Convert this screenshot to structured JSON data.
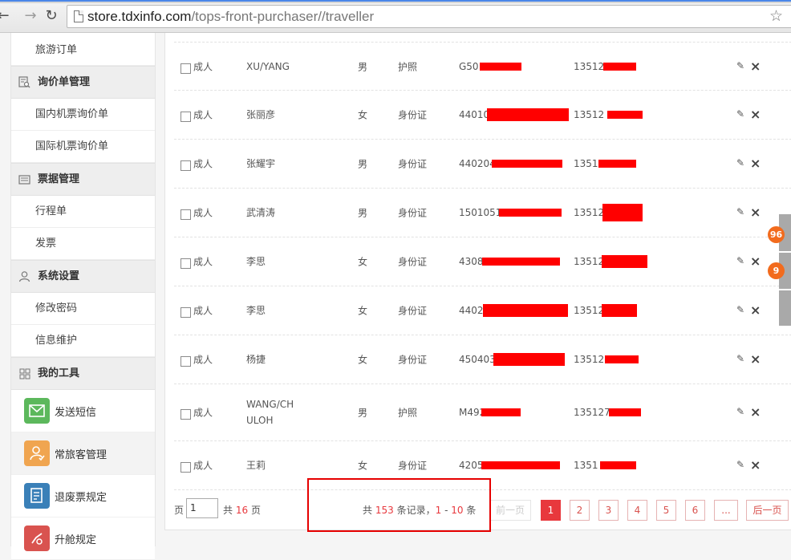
{
  "browser": {
    "url_host": "store.tdxinfo.com",
    "url_path": "/tops-front-purchaser//traveller"
  },
  "sidebar": {
    "top_item": "旅游订单",
    "groups": [
      {
        "title": "询价单管理",
        "icon": "search-doc-icon",
        "items": [
          "国内机票询价单",
          "国际机票询价单"
        ]
      },
      {
        "title": "票据管理",
        "icon": "receipt-icon",
        "items": [
          "行程单",
          "发票"
        ]
      },
      {
        "title": "系统设置",
        "icon": "user-icon",
        "items": [
          "修改密码",
          "信息维护"
        ]
      },
      {
        "title": "我的工具",
        "icon": "grid-icon",
        "items": []
      }
    ],
    "tools": [
      {
        "label": "发送短信",
        "icon": "mail-icon",
        "color": "#5cb85c"
      },
      {
        "label": "常旅客管理",
        "icon": "traveller-icon",
        "color": "#f0a550"
      },
      {
        "label": "退废票规定",
        "icon": "document-icon",
        "color": "#3a80b8"
      },
      {
        "label": "升舱规定",
        "icon": "upgrade-icon",
        "color": "#d9534f"
      }
    ]
  },
  "rows": [
    {
      "type": "成人",
      "name": "XU/YANG",
      "gender": "男",
      "doc_type": "护照",
      "doc_no": "G50",
      "phone": "13512"
    },
    {
      "type": "成人",
      "name": "张丽彦",
      "gender": "女",
      "doc_type": "身份证",
      "doc_no": "44010",
      "phone": "13512"
    },
    {
      "type": "成人",
      "name": "张耀宇",
      "gender": "男",
      "doc_type": "身份证",
      "doc_no": "440204",
      "phone": "1351"
    },
    {
      "type": "成人",
      "name": "武清涛",
      "gender": "男",
      "doc_type": "身份证",
      "doc_no": "1501051",
      "phone": "13512"
    },
    {
      "type": "成人",
      "name": "李思",
      "gender": "女",
      "doc_type": "身份证",
      "doc_no": "4308",
      "phone": "13512"
    },
    {
      "type": "成人",
      "name": "李思",
      "gender": "女",
      "doc_type": "身份证",
      "doc_no": "4402",
      "phone": "13512"
    },
    {
      "type": "成人",
      "name": "杨捷",
      "gender": "女",
      "doc_type": "身份证",
      "doc_no": "450403",
      "phone": "135127"
    },
    {
      "type": "成人",
      "name": "WANG/CHULOH",
      "name_line1": "WANG/CH",
      "name_line2": "ULOH",
      "gender": "男",
      "doc_type": "护照",
      "doc_no": "M492",
      "phone": "135127"
    },
    {
      "type": "成人",
      "name": "王莉",
      "gender": "女",
      "doc_type": "身份证",
      "doc_no": "42058",
      "phone": "1351"
    }
  ],
  "pagination": {
    "page_label": "页",
    "page_value": "1",
    "total_prefix": "共",
    "total_pages": "16",
    "total_suffix": "页",
    "records_prefix": "共",
    "records_total": "153",
    "records_mid": "条记录，",
    "records_from": "1",
    "records_sep": "-",
    "records_to": "10",
    "records_suffix": "条",
    "prev": "前一页",
    "pages": [
      "1",
      "2",
      "3",
      "4",
      "5",
      "6",
      "..."
    ],
    "next": "后一页"
  },
  "float_badges": [
    "96",
    "9"
  ],
  "colors": {
    "accent": "#e8383d",
    "redaction": "#ff0000",
    "highlight": "#e60000"
  }
}
